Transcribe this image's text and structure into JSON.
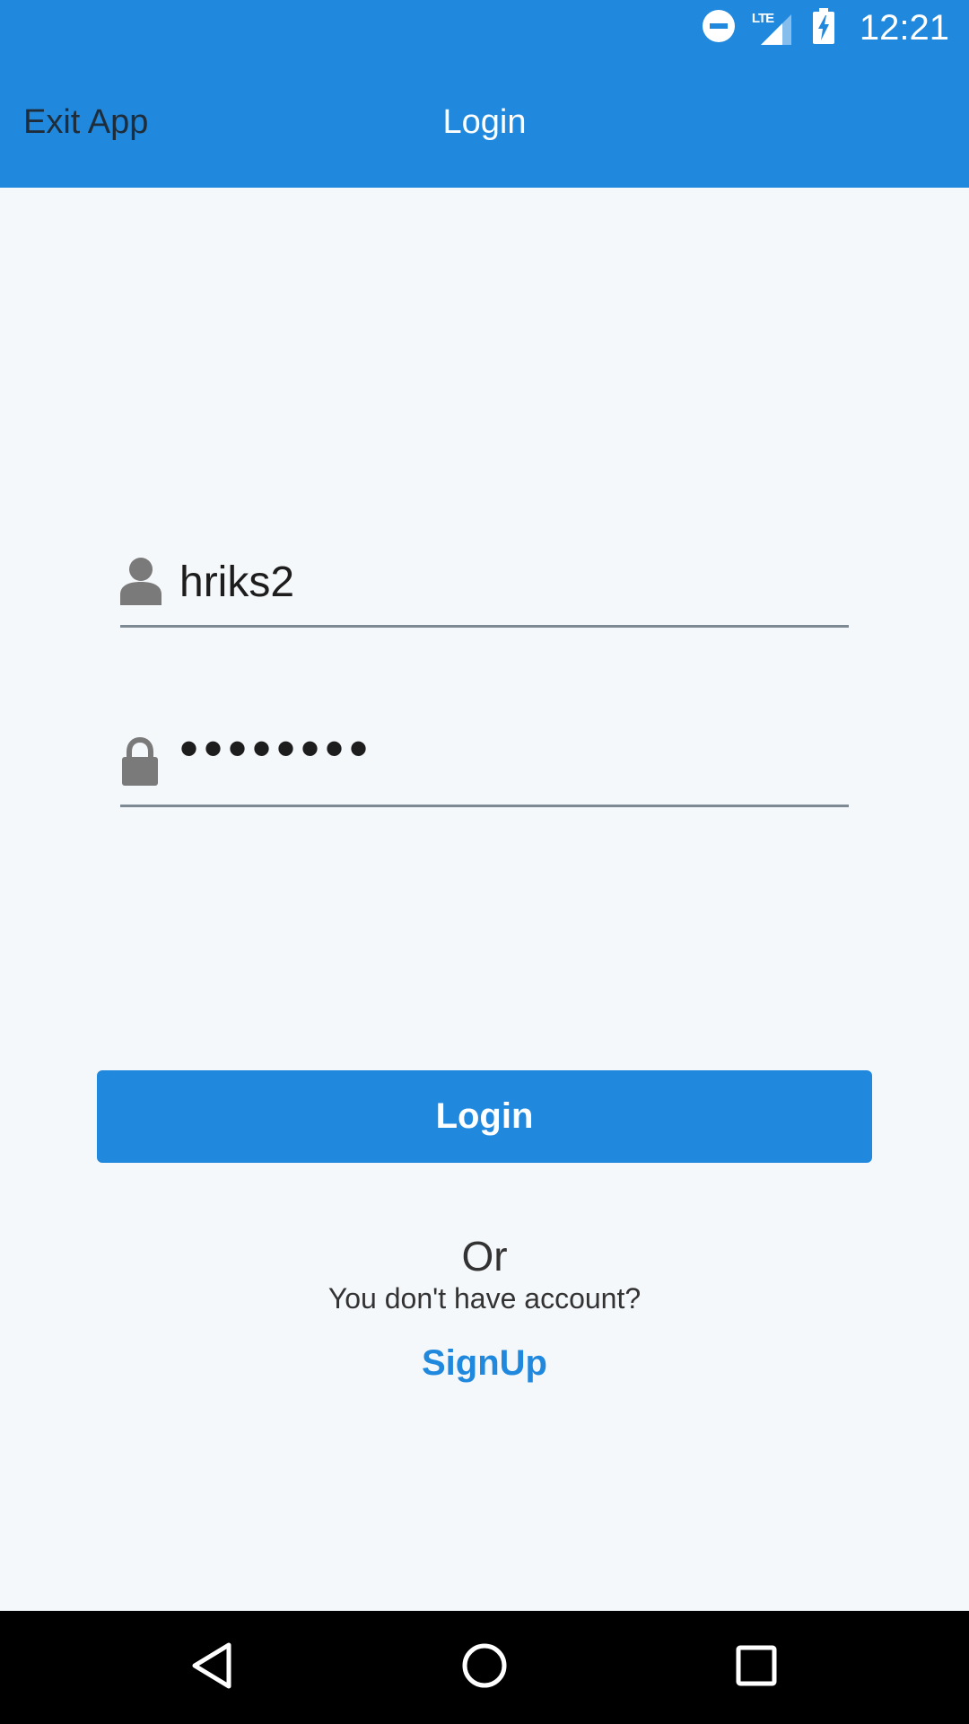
{
  "status_bar": {
    "time": "12:21",
    "network_label": "LTE",
    "icons": [
      "do-not-disturb-icon",
      "signal-icon",
      "battery-charging-icon"
    ]
  },
  "toolbar": {
    "exit_label": "Exit App",
    "title": "Login"
  },
  "form": {
    "username": {
      "value": "hriks2",
      "icon": "user-icon"
    },
    "password": {
      "masked_value": "••••••••",
      "icon": "lock-icon"
    }
  },
  "actions": {
    "login_label": "Login",
    "or_text": "Or",
    "no_account_text": "You don't have account?",
    "signup_label": "SignUp"
  },
  "nav_bar": {
    "icons": [
      "back-icon",
      "home-icon",
      "recents-icon"
    ]
  },
  "colors": {
    "accent": "#2189DD",
    "background": "#F5F8FB",
    "field_line": "#7D8A94",
    "icon_gray": "#7A7A7A"
  }
}
